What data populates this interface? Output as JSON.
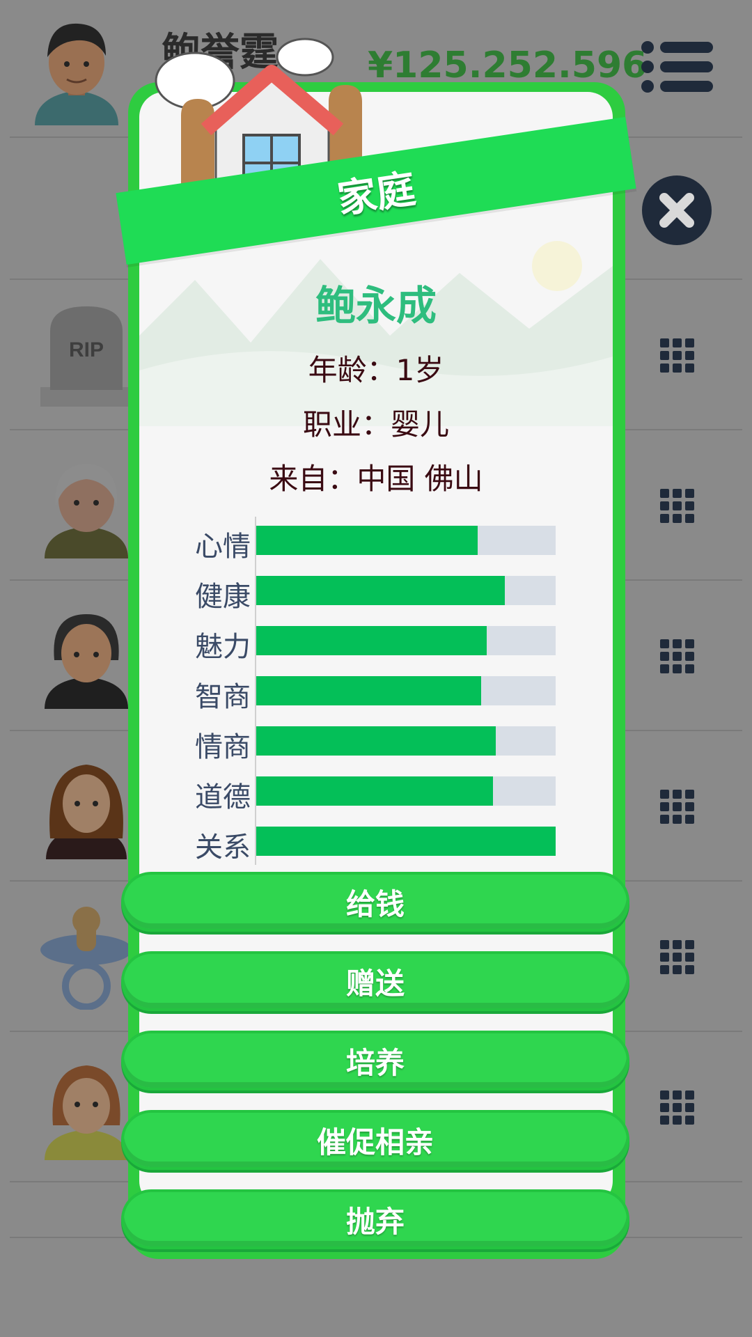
{
  "header": {
    "player_name": "鲍誉霆",
    "money": "¥125.252.596"
  },
  "modal": {
    "title": "家庭",
    "character": {
      "name": "鲍永成",
      "age_line": "年龄：1岁",
      "job_line": "职业：婴儿",
      "origin_line": "来自：中国 佛山"
    },
    "stats": [
      {
        "label": "心情",
        "value": 74
      },
      {
        "label": "健康",
        "value": 83
      },
      {
        "label": "魅力",
        "value": 77
      },
      {
        "label": "智商",
        "value": 75
      },
      {
        "label": "情商",
        "value": 80
      },
      {
        "label": "道德",
        "value": 79
      },
      {
        "label": "关系",
        "value": 100
      }
    ],
    "buttons": [
      {
        "label": "给钱"
      },
      {
        "label": "赠送"
      },
      {
        "label": "培养"
      },
      {
        "label": "催促相亲"
      },
      {
        "label": "抛弃"
      }
    ]
  },
  "background_list": {
    "gravestone_text": "RIP"
  },
  "colors": {
    "overlay_gray": "#8a8a8a",
    "modal_green": "#2ecc40",
    "bar_fill": "#04bf58",
    "bar_track": "#d8dee6",
    "name_color": "#2ebd7e"
  },
  "icons": [
    "menu-icon",
    "close-icon",
    "grid-icon",
    "house-icon",
    "cloud-icon",
    "gravestone-icon",
    "pacifier-icon"
  ]
}
